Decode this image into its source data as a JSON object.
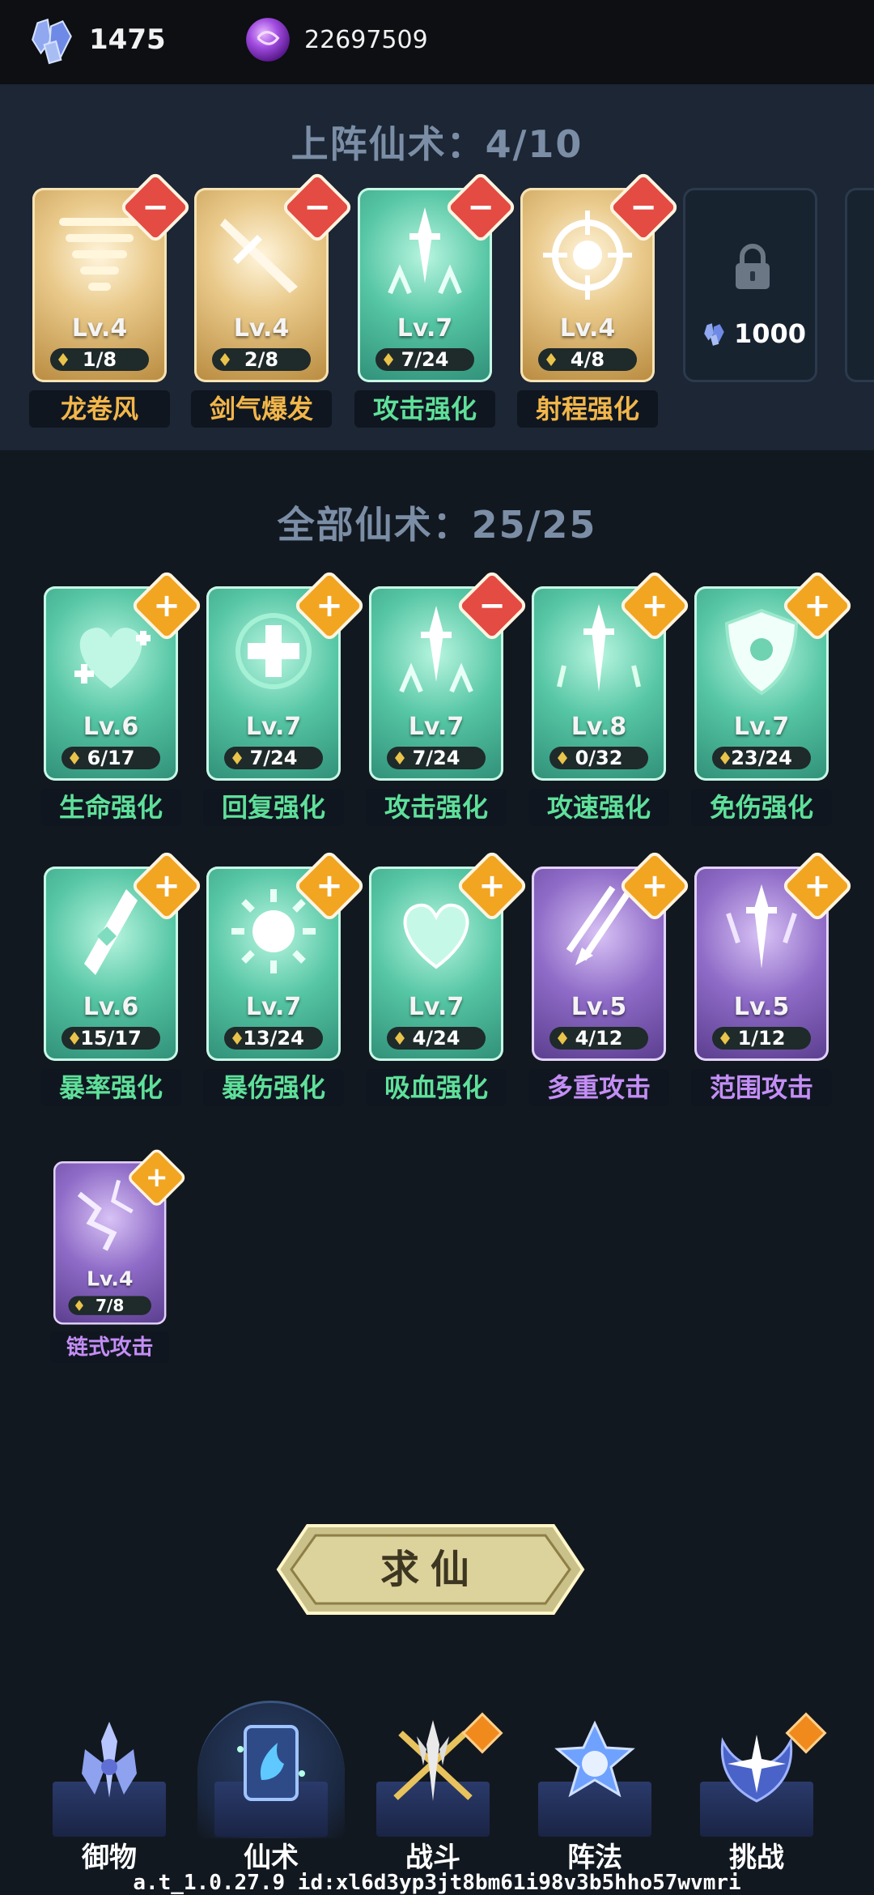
{
  "currency": {
    "crystal": "1475",
    "orb": "22697509"
  },
  "equipped": {
    "title": "上阵仙术：4/10",
    "cards": [
      {
        "name": "龙卷风",
        "level": "Lv.4",
        "progress": "1/8",
        "rarity": "gold",
        "art": "tornado-icon",
        "badge": "minus"
      },
      {
        "name": "剑气爆发",
        "level": "Lv.4",
        "progress": "2/8",
        "rarity": "gold",
        "art": "sword-burst-icon",
        "badge": "minus"
      },
      {
        "name": "攻击强化",
        "level": "Lv.7",
        "progress": "7/24",
        "rarity": "teal",
        "art": "sword-up-icon",
        "badge": "minus"
      },
      {
        "name": "射程强化",
        "level": "Lv.4",
        "progress": "4/8",
        "rarity": "gold",
        "art": "crosshair-icon",
        "badge": "minus"
      }
    ],
    "locked_slot": {
      "cost": "1000"
    }
  },
  "all": {
    "title": "全部仙术：25/25",
    "cards": [
      {
        "name": "生命强化",
        "level": "Lv.6",
        "progress": "6/17",
        "rarity": "teal",
        "art": "heart-plus-icon",
        "badge": "plus"
      },
      {
        "name": "回复强化",
        "level": "Lv.7",
        "progress": "7/24",
        "rarity": "teal",
        "art": "heal-cross-icon",
        "badge": "plus"
      },
      {
        "name": "攻击强化",
        "level": "Lv.7",
        "progress": "7/24",
        "rarity": "teal",
        "art": "sword-up-icon",
        "badge": "minus"
      },
      {
        "name": "攻速强化",
        "level": "Lv.8",
        "progress": "0/32",
        "rarity": "teal",
        "art": "swift-sword-icon",
        "badge": "plus"
      },
      {
        "name": "免伤强化",
        "level": "Lv.7",
        "progress": "23/24",
        "rarity": "teal",
        "art": "shield-icon",
        "badge": "plus"
      },
      {
        "name": "暴率强化",
        "level": "Lv.6",
        "progress": "15/17",
        "rarity": "teal",
        "art": "crit-blade-icon",
        "badge": "plus"
      },
      {
        "name": "暴伤强化",
        "level": "Lv.7",
        "progress": "13/24",
        "rarity": "teal",
        "art": "sun-burst-icon",
        "badge": "plus"
      },
      {
        "name": "吸血强化",
        "level": "Lv.7",
        "progress": "4/24",
        "rarity": "teal",
        "art": "heart-icon",
        "badge": "plus"
      },
      {
        "name": "多重攻击",
        "level": "Lv.5",
        "progress": "4/12",
        "rarity": "purple",
        "art": "multi-arrow-icon",
        "badge": "plus"
      },
      {
        "name": "范围攻击",
        "level": "Lv.5",
        "progress": "1/12",
        "rarity": "purple",
        "art": "sword-rain-icon",
        "badge": "plus"
      },
      {
        "name": "链式攻击",
        "level": "Lv.4",
        "progress": "7/8",
        "rarity": "purple",
        "art": "lightning-icon",
        "badge": "plus"
      }
    ]
  },
  "request_button": "求仙",
  "nav": [
    {
      "label": "御物",
      "icon": "swords-icon",
      "active": false,
      "alert": false
    },
    {
      "label": "仙术",
      "icon": "spell-card-icon",
      "active": true,
      "alert": false
    },
    {
      "label": "战斗",
      "icon": "trident-icon",
      "active": false,
      "alert": true
    },
    {
      "label": "阵法",
      "icon": "formation-icon",
      "active": false,
      "alert": false
    },
    {
      "label": "挑战",
      "icon": "challenge-icon",
      "active": false,
      "alert": true
    }
  ],
  "footer": "a.t_1.0.27.9 id:xl6d3yp3jt8bm61i98v3b5hho57wvmri",
  "colors": {
    "gold": "#f2b64a",
    "teal": "#5fe09a",
    "purple": "#c48ef5",
    "minus": "#e34b43",
    "plus": "#f2a521"
  }
}
